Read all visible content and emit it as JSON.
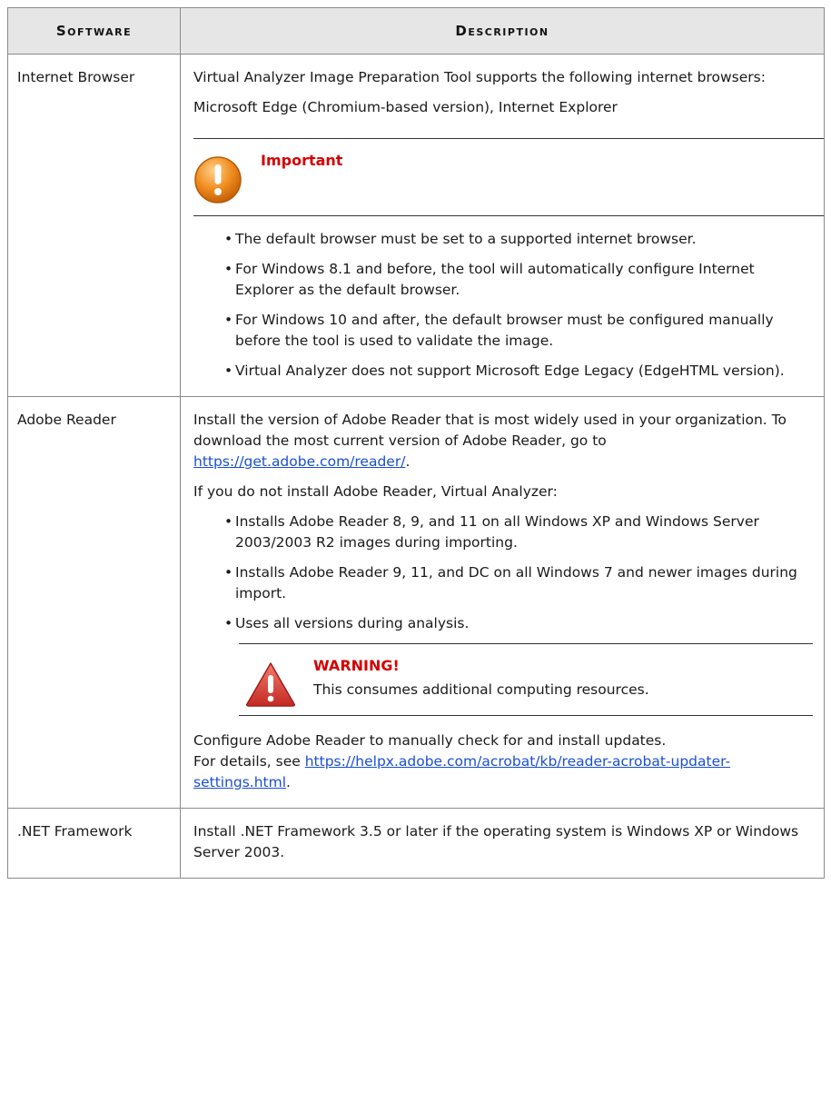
{
  "table": {
    "headers": [
      "Software",
      "Description"
    ],
    "rows": [
      {
        "software": "Internet Browser",
        "intro": "Virtual Analyzer Image Preparation Tool supports the following internet browsers:",
        "browsers": "Microsoft Edge (Chromium-based version), Internet Explorer",
        "note_title": "Important",
        "bullets": [
          "The default browser must be set to a supported internet browser.",
          "For Windows 8.1 and before, the tool will automatically configure Internet Explorer as the default browser.",
          "For Windows 10 and after, the default browser must be configured manually before the tool is used to validate the image.",
          "Virtual Analyzer does not support Microsoft Edge Legacy (EdgeHTML version)."
        ]
      },
      {
        "software": "Adobe Reader",
        "intro_text": "Install the version of Adobe Reader that is most widely used in your organization. To download the most current version of Adobe Reader, go to ",
        "intro_link": "https://get.adobe.com/reader/",
        "intro_end": ".",
        "if_not": "If you do not install Adobe Reader, Virtual Analyzer:",
        "bullets": [
          "Installs Adobe Reader 8, 9, and 11 on all Windows XP and Windows Server 2003/2003 R2 images during importing.",
          "Installs Adobe Reader 9, 11, and DC on all Windows 7 and newer images during import.",
          "Uses all versions during analysis."
        ],
        "warning_title": "WARNING!",
        "warning_text": "This consumes additional computing resources.",
        "config_line1": "Configure Adobe Reader to manually check for and install updates.",
        "config_prefix": "For details, see ",
        "config_link": "https://helpx.adobe.com/acrobat/kb/reader-acrobat-updater-settings.html",
        "config_end": "."
      },
      {
        "software": ".NET Framework",
        "text": "Install .NET Framework 3.5 or later if the operating system is Windows XP or Windows Server 2003."
      }
    ]
  },
  "colors": {
    "header_bg": "#e6e6e6",
    "alert_red": "#d40000",
    "link": "#1a4fd1",
    "important_icon": "#f08a1c",
    "warning_icon": "#d9302b"
  },
  "icons": {
    "important": "important-icon",
    "warning": "warning-icon"
  }
}
